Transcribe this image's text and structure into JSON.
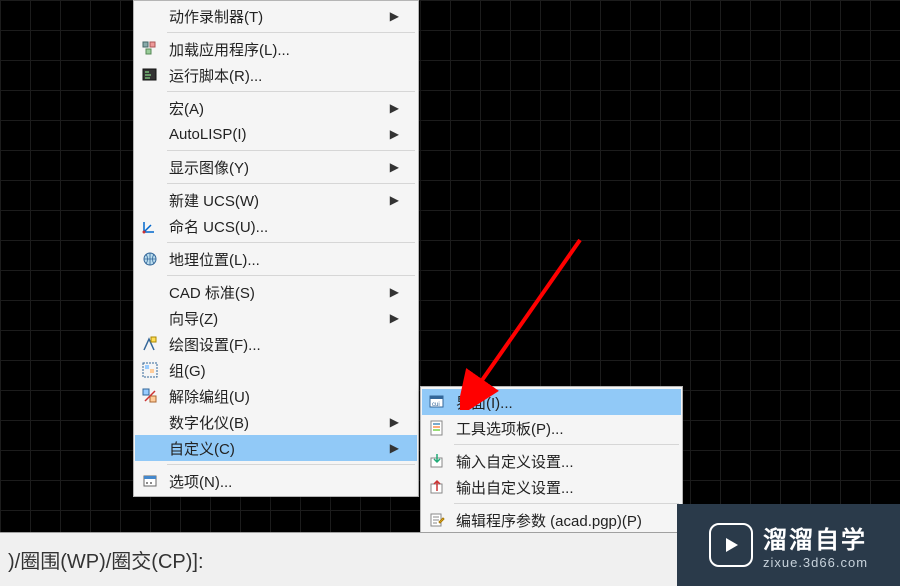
{
  "menu": {
    "items": [
      {
        "label": "动作录制器(T)",
        "hasSubmenu": true,
        "separatorAfter": true
      },
      {
        "label": "加载应用程序(L)...",
        "icon": "apps-icon"
      },
      {
        "label": "运行脚本(R)...",
        "icon": "script-icon",
        "separatorAfter": true
      },
      {
        "label": "宏(A)",
        "hasSubmenu": true
      },
      {
        "label": "AutoLISP(I)",
        "hasSubmenu": true,
        "separatorAfter": true
      },
      {
        "label": "显示图像(Y)",
        "hasSubmenu": true,
        "separatorAfter": true
      },
      {
        "label": "新建 UCS(W)",
        "hasSubmenu": true
      },
      {
        "label": "命名 UCS(U)...",
        "icon": "ucs-icon",
        "separatorAfter": true
      },
      {
        "label": "地理位置(L)...",
        "icon": "globe-icon",
        "separatorAfter": true
      },
      {
        "label": "CAD 标准(S)",
        "hasSubmenu": true
      },
      {
        "label": "向导(Z)",
        "hasSubmenu": true
      },
      {
        "label": "绘图设置(F)...",
        "icon": "draft-settings-icon"
      },
      {
        "label": "组(G)",
        "icon": "group-icon"
      },
      {
        "label": "解除编组(U)",
        "icon": "ungroup-icon"
      },
      {
        "label": "数字化仪(B)",
        "hasSubmenu": true
      },
      {
        "label": "自定义(C)",
        "hasSubmenu": true,
        "highlight": true,
        "separatorAfter": true
      },
      {
        "label": "选项(N)...",
        "icon": "options-icon"
      }
    ]
  },
  "submenu": {
    "items": [
      {
        "label": "界面(I)...",
        "icon": "cui-icon",
        "highlight": true
      },
      {
        "label": "工具选项板(P)...",
        "icon": "palette-icon",
        "separatorAfter": true
      },
      {
        "label": "输入自定义设置...",
        "icon": "import-icon"
      },
      {
        "label": "输出自定义设置...",
        "icon": "export-icon",
        "separatorAfter": true
      },
      {
        "label": "编辑程序参数 (acad.pgp)(P)",
        "icon": "edit-pgp-icon"
      }
    ]
  },
  "command_bar": ")/圈围(WP)/圈交(CP)]:",
  "logo": {
    "main": "溜溜自学",
    "sub": "zixue.3d66.com"
  }
}
